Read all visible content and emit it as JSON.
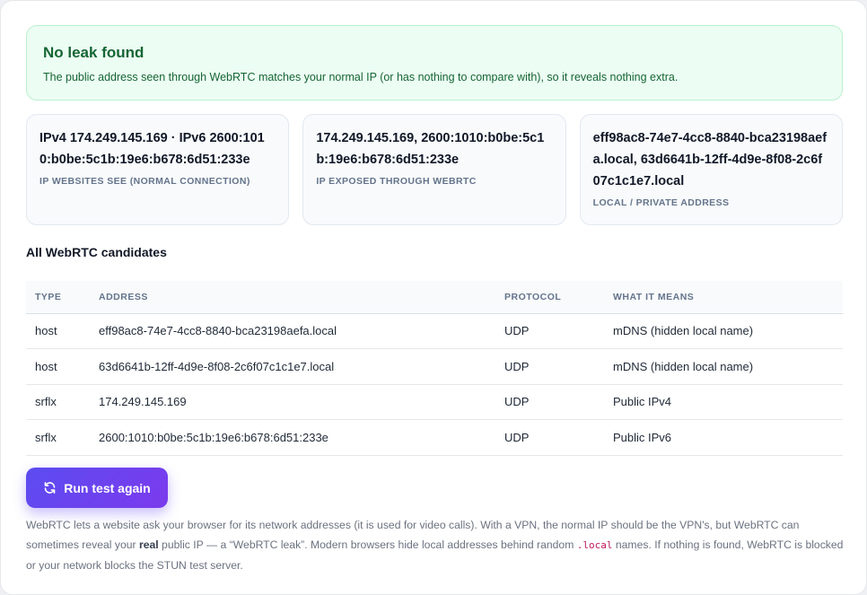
{
  "status": {
    "title": "No leak found",
    "message": "The public address seen through WebRTC matches your normal IP (or has nothing to compare with), so it reveals nothing extra."
  },
  "stats": [
    {
      "value": "IPv4 174.249.145.169 · IPv6 2600:1010:b0be:5c1b:19e6:b678:6d51:233e",
      "label": "IP WEBSITES SEE (NORMAL CONNECTION)"
    },
    {
      "value": "174.249.145.169, 2600:1010:b0be:5c1b:19e6:b678:6d51:233e",
      "label": "IP EXPOSED THROUGH WEBRTC"
    },
    {
      "value": "eff98ac8-74e7-4cc8-8840-bca23198aefa.local, 63d6641b-12ff-4d9e-8f08-2c6f07c1c1e7.local",
      "label": "LOCAL / PRIVATE ADDRESS"
    }
  ],
  "candidates": {
    "title": "All WebRTC candidates",
    "headers": [
      "TYPE",
      "ADDRESS",
      "PROTOCOL",
      "WHAT IT MEANS"
    ],
    "rows": [
      [
        "host",
        "eff98ac8-74e7-4cc8-8840-bca23198aefa.local",
        "UDP",
        "mDNS (hidden local name)"
      ],
      [
        "host",
        "63d6641b-12ff-4d9e-8f08-2c6f07c1c1e7.local",
        "UDP",
        "mDNS (hidden local name)"
      ],
      [
        "srflx",
        "174.249.145.169",
        "UDP",
        "Public IPv4"
      ],
      [
        "srflx",
        "2600:1010:b0be:5c1b:19e6:b678:6d51:233e",
        "UDP",
        "Public IPv6"
      ]
    ]
  },
  "run_button": {
    "label": "Run test again",
    "icon": "refresh-icon"
  },
  "footnote": {
    "part1": "WebRTC lets a website ask your browser for its network addresses (it is used for video calls). With a VPN, the normal IP should be the VPN's, but WebRTC can sometimes reveal your ",
    "strong": "real",
    "part2": " public IP — a “WebRTC leak”. Modern browsers hide local addresses behind random ",
    "code": ".local",
    "part3": " names. If nothing is found, WebRTC is blocked or your network blocks the STUN test server."
  },
  "colors": {
    "success_bg": "#ecfdf3",
    "success_text": "#166534",
    "accent": "#6d3ff0"
  }
}
